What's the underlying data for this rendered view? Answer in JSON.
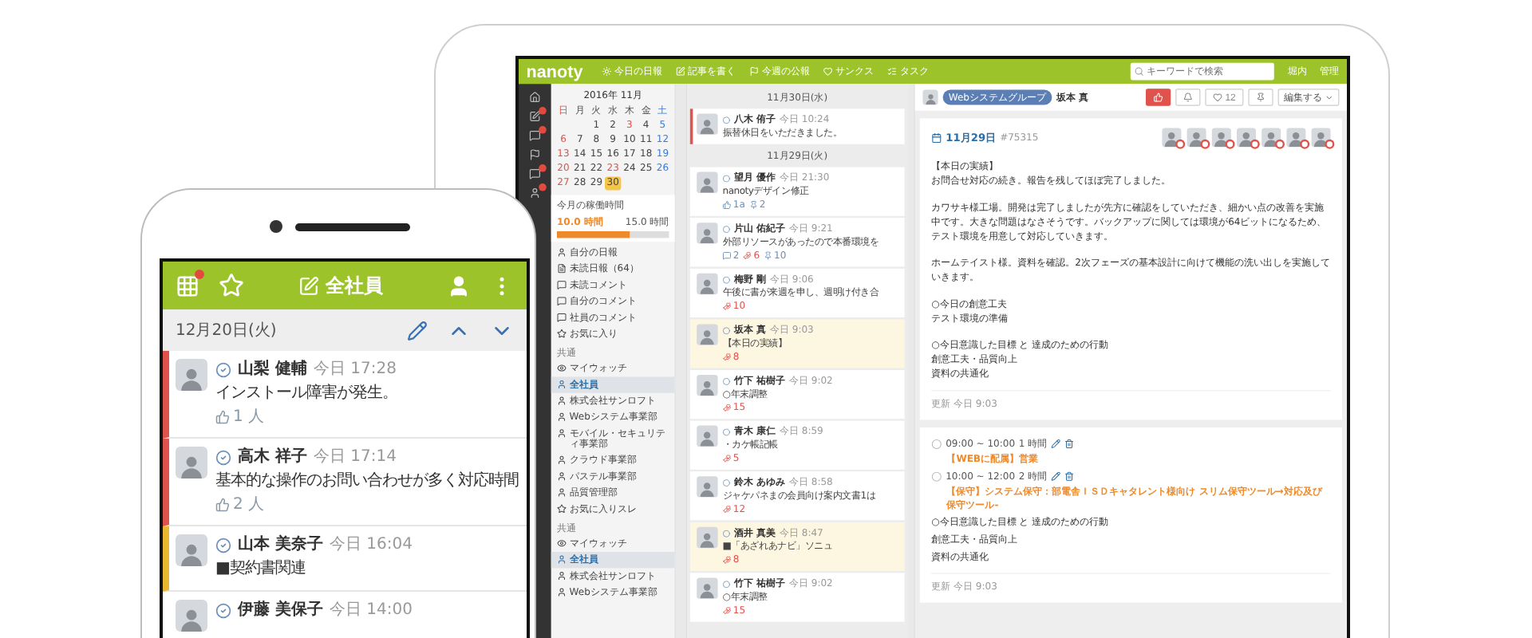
{
  "tablet": {
    "topbar": {
      "logo": "nanoty",
      "nav": [
        {
          "kind": "sun",
          "label": "今日の日報"
        },
        {
          "kind": "pen",
          "label": "記事を書く"
        },
        {
          "kind": "flag",
          "label": "今週の公報"
        },
        {
          "kind": "heart",
          "label": "サンクス"
        },
        {
          "kind": "task",
          "label": "タスク"
        }
      ],
      "search": {
        "placeholder": "キーワードで検索"
      },
      "user": "堀内",
      "settings": "管理"
    },
    "rail": [
      {
        "kind": "home",
        "badge": false
      },
      {
        "kind": "edit",
        "badge": true
      },
      {
        "kind": "chat",
        "badge": true
      },
      {
        "kind": "flag",
        "badge": false
      },
      {
        "kind": "chat",
        "badge": true
      },
      {
        "kind": "user",
        "badge": true
      }
    ],
    "calendar": {
      "title": "2016年 11月",
      "weekdays": [
        "日",
        "月",
        "火",
        "水",
        "木",
        "金",
        "土"
      ],
      "weeks": [
        [
          {
            "label": "1",
            "holiday": false,
            "selected": false
          },
          {
            "label": "2",
            "holiday": false,
            "selected": false
          },
          {
            "label": "3",
            "holiday": true,
            "selected": false
          },
          {
            "label": "4",
            "holiday": false,
            "selected": false
          },
          {
            "label": "5",
            "holiday": false,
            "selected": false
          }
        ],
        [
          {
            "label": "6",
            "holiday": true,
            "selected": false
          },
          {
            "label": "7",
            "holiday": false,
            "selected": false
          },
          {
            "label": "8",
            "holiday": false,
            "selected": false
          },
          {
            "label": "9",
            "holiday": false,
            "selected": false
          },
          {
            "label": "10",
            "holiday": false,
            "selected": false
          },
          {
            "label": "11",
            "holiday": false,
            "selected": false
          },
          {
            "label": "12",
            "holiday": false,
            "selected": false
          }
        ],
        [
          {
            "label": "13",
            "holiday": true,
            "selected": false
          },
          {
            "label": "14",
            "holiday": false,
            "selected": false
          },
          {
            "label": "15",
            "holiday": false,
            "selected": false
          },
          {
            "label": "16",
            "holiday": false,
            "selected": false
          },
          {
            "label": "17",
            "holiday": false,
            "selected": false
          },
          {
            "label": "18",
            "holiday": false,
            "selected": false
          },
          {
            "label": "19",
            "holiday": false,
            "selected": false
          }
        ],
        [
          {
            "label": "20",
            "holiday": true,
            "selected": false
          },
          {
            "label": "21",
            "holiday": false,
            "selected": false
          },
          {
            "label": "22",
            "holiday": false,
            "selected": false
          },
          {
            "label": "23",
            "holiday": true,
            "selected": false
          },
          {
            "label": "24",
            "holiday": false,
            "selected": false
          },
          {
            "label": "25",
            "holiday": false,
            "selected": false
          },
          {
            "label": "26",
            "holiday": false,
            "selected": false
          }
        ],
        [
          {
            "label": "27",
            "holiday": true,
            "selected": false
          },
          {
            "label": "28",
            "holiday": false,
            "selected": false
          },
          {
            "label": "29",
            "holiday": false,
            "selected": false
          },
          {
            "label": "30",
            "holiday": false,
            "selected": true
          }
        ]
      ]
    },
    "work_hours": {
      "title": "今月の稼働時間",
      "value": "10.0 時間",
      "target": "15.0 時間",
      "level": 0.65
    },
    "menu": [
      {
        "items": [
          {
            "kind": "user",
            "label": "自分の日報",
            "selected": false
          },
          {
            "kind": "doc",
            "label": "未読日報（64）",
            "selected": false
          },
          {
            "kind": "chat",
            "label": "未読コメント",
            "selected": false
          },
          {
            "kind": "chat",
            "label": "自分のコメント",
            "selected": false
          },
          {
            "kind": "chat",
            "label": "社員のコメント",
            "selected": false
          },
          {
            "kind": "star",
            "label": "お気に入り",
            "selected": false
          }
        ]
      },
      {
        "heading": "共通",
        "items": [
          {
            "kind": "eye",
            "label": "マイウォッチ",
            "selected": false
          },
          {
            "kind": "user",
            "label": "全社員",
            "selected": true
          },
          {
            "kind": "user",
            "label": "株式会社サンロフト",
            "selected": false
          },
          {
            "kind": "user",
            "label": "Webシステム事業部",
            "selected": false
          },
          {
            "kind": "user",
            "label": "モバイル・セキュリティ事業部",
            "selected": false
          },
          {
            "kind": "user",
            "label": "クラウド事業部",
            "selected": false
          },
          {
            "kind": "user",
            "label": "パステル事業部",
            "selected": false
          },
          {
            "kind": "user",
            "label": "品質管理部",
            "selected": false
          },
          {
            "kind": "star",
            "label": "お気に入りスレ",
            "selected": false
          }
        ]
      },
      {
        "heading": "共通",
        "items": [
          {
            "kind": "eye",
            "label": "マイウォッチ",
            "selected": false
          },
          {
            "kind": "user",
            "label": "全社員",
            "selected": true
          },
          {
            "kind": "user",
            "label": "株式会社サンロフト",
            "selected": false
          },
          {
            "kind": "user",
            "label": "Webシステム事業部",
            "selected": false
          }
        ]
      }
    ],
    "feed": [
      {
        "kind": "date",
        "label": "11月30日(水)"
      },
      {
        "kind": "post",
        "name": "八木 侑子",
        "time": "今日 10:24",
        "text": "振替休日をいただきました。",
        "unread": true,
        "highlighted": false
      },
      {
        "kind": "date",
        "label": "11月29日(火)"
      },
      {
        "kind": "post",
        "name": "望月 優作",
        "time": "今日 21:30",
        "text": "nanotyデザイン修正",
        "unread": false,
        "highlighted": false,
        "reactions": [
          {
            "kind": "like",
            "count": "1a"
          },
          {
            "kind": "pin",
            "count": "2"
          }
        ]
      },
      {
        "kind": "post",
        "name": "片山 佑紀子",
        "time": "今日 9:21",
        "text": "外部リソースがあったので本番環境を",
        "unread": false,
        "highlighted": false,
        "reactions": [
          {
            "kind": "comment",
            "count": "2"
          },
          {
            "kind": "thanks",
            "count": "6"
          },
          {
            "kind": "pin",
            "count": "10"
          }
        ]
      },
      {
        "kind": "post",
        "name": "梅野 剛",
        "time": "今日 9:06",
        "text": "午後に書が来週を申し、週明け付き合",
        "unread": false,
        "highlighted": false,
        "reactions": [
          {
            "kind": "thanks",
            "count": "10"
          }
        ]
      },
      {
        "kind": "post",
        "name": "坂本 真",
        "time": "今日 9:03",
        "text": "【本日の実績】",
        "unread": false,
        "highlighted": true,
        "reactions": [
          {
            "kind": "thanks",
            "count": "8"
          }
        ]
      },
      {
        "kind": "post",
        "name": "竹下 祐樹子",
        "time": "今日 9:02",
        "text": "○年末調整",
        "unread": false,
        "highlighted": false,
        "reactions": [
          {
            "kind": "thanks",
            "count": "15"
          }
        ]
      },
      {
        "kind": "post",
        "name": "青木 康仁",
        "time": "今日 8:59",
        "text": "・カケ帳記帳",
        "unread": false,
        "highlighted": false,
        "reactions": [
          {
            "kind": "thanks",
            "count": "5"
          }
        ]
      },
      {
        "kind": "post",
        "name": "鈴木 あゆみ",
        "time": "今日 8:58",
        "text": "ジャケパネまの会員向け案内文書1は",
        "unread": false,
        "highlighted": false,
        "reactions": [
          {
            "kind": "thanks",
            "count": "12"
          }
        ]
      },
      {
        "kind": "post",
        "name": "酒井 真美",
        "time": "今日 8:47",
        "text": "■「あざれあナビ」ソニュ",
        "unread": false,
        "highlighted": true,
        "reactions": [
          {
            "kind": "thanks",
            "count": "8"
          }
        ]
      },
      {
        "kind": "post",
        "name": "竹下 祐樹子",
        "time": "今日 9:02",
        "text": "○年末調整",
        "unread": false,
        "highlighted": false,
        "reactions": [
          {
            "kind": "thanks",
            "count": "15"
          }
        ]
      }
    ],
    "detail": {
      "group": "Webシステムグループ",
      "author": "坂本 真",
      "actions": [
        {
          "kind": "like",
          "active": true
        },
        {
          "kind": "bell",
          "active": false
        },
        {
          "kind": "heart",
          "active": false,
          "count": "12"
        },
        {
          "kind": "pin",
          "active": false
        }
      ],
      "edit_button": "編集する",
      "date": "11月29日",
      "post_id": "#75315",
      "readers": [
        {
          "stamp": true
        },
        {
          "stamp": true
        },
        {
          "stamp": true
        },
        {
          "stamp": true
        },
        {
          "stamp": true
        },
        {
          "stamp": true
        },
        {
          "stamp": true
        }
      ],
      "body": [
        [
          "【本日の実績】",
          "お問合せ対応の続き。報告を残してほぼ完了しました。"
        ],
        [
          "カワサキ様工場。開発は完了しましたが先方に確認をしていただき、細かい点の改善を実施中です。大きな問題はなさそうです。バックアップに関しては環境が64ビットになるため、テスト環境を用意して対応していきます。"
        ],
        [
          "ホームテイスト様。資料を確認。2次フェーズの基本設計に向けて機能の洗い出しを実施していきます。"
        ],
        [
          "○今日の創意工夫",
          "テスト環境の準備"
        ],
        [
          "○今日意識した目標 と 達成のための行動",
          "創意工夫・品質向上",
          "資料の共通化"
        ]
      ],
      "updated": "更新 今日 9:03",
      "schedule": [
        {
          "time": "09:00 ~ 10:00",
          "duration": "1 時間",
          "title": "【WEBに配属】営業"
        },
        {
          "time": "10:00 ~ 12:00",
          "duration": "2 時間",
          "title": "【保守】システム保守：部電舎ＩＳＤキャタレント様向け スリム保守ツール→対応及び保守ツール‐"
        }
      ],
      "notes": [
        "○今日意識した目標 と 達成のための行動",
        "創意工夫・品質向上",
        "資料の共通化"
      ],
      "schedule_updated": "更新 今日 9:03"
    }
  },
  "phone": {
    "header": {
      "title": "全社員",
      "notification": true
    },
    "date": "12月20日(火)",
    "posts": [
      {
        "name": "山梨 健輔",
        "time": "今日 17:28",
        "text": "インストール障害が発生。",
        "likes": "1 人",
        "color": "#e0524c"
      },
      {
        "name": "高木 祥子",
        "time": "今日 17:14",
        "text": "基本的な操作のお問い合わせが多く対応時間",
        "likes": "2 人",
        "color": "#e0524c"
      },
      {
        "name": "山本 美奈子",
        "time": "今日 16:04",
        "text": "■契約書関連",
        "color": "#e8b830"
      },
      {
        "name": "伊藤 美保子",
        "time": "今日 14:00"
      }
    ]
  }
}
